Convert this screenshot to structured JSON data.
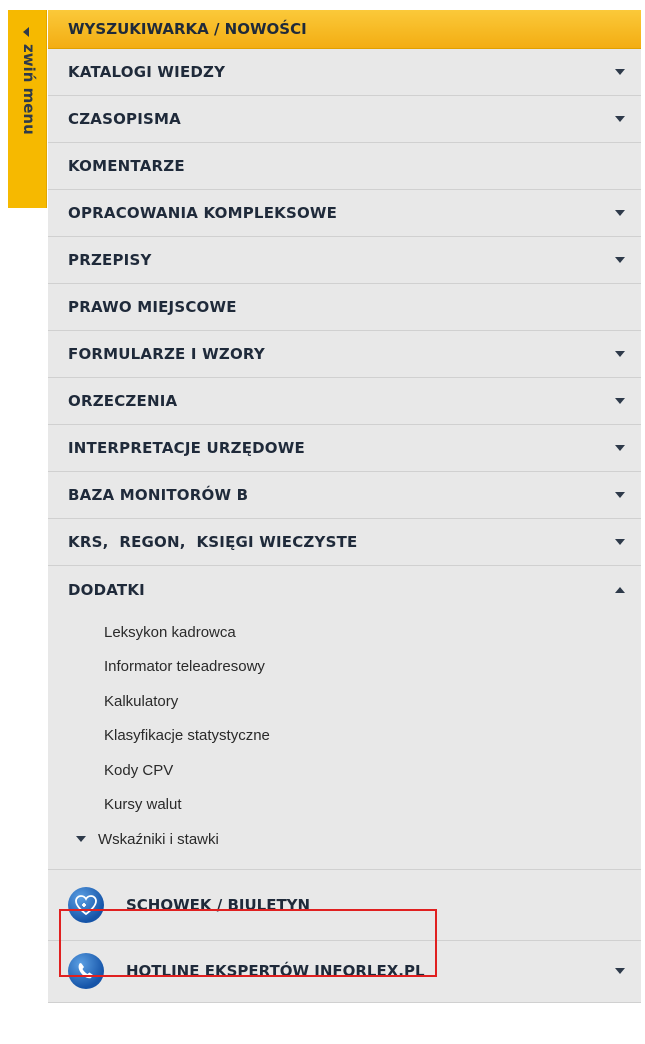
{
  "collapse_tab": {
    "label": "zwiń menu",
    "icon": "triangle-left-icon"
  },
  "header": {
    "label": "WYSZUKIWARKA / NOWOŚCI"
  },
  "menu_items": [
    {
      "label": "KATALOGI WIEDZY",
      "caret": "down"
    },
    {
      "label": "CZASOPISMA",
      "caret": "down"
    },
    {
      "label": "KOMENTARZE",
      "caret": "none"
    },
    {
      "label": "OPRACOWANIA KOMPLEKSOWE",
      "caret": "down"
    },
    {
      "label": "PRZEPISY",
      "caret": "down"
    },
    {
      "label": "PRAWO MIEJSCOWE",
      "caret": "none"
    },
    {
      "label": "FORMULARZE I WZORY",
      "caret": "down"
    },
    {
      "label": "ORZECZENIA",
      "caret": "down"
    },
    {
      "label": "INTERPRETACJE URZĘDOWE",
      "caret": "down"
    },
    {
      "label": "BAZA MONITORÓW B",
      "caret": "down"
    },
    {
      "label": "KRS,  REGON,  KSIĘGI WIECZYSTE",
      "caret": "down"
    },
    {
      "label": "DODATKI",
      "caret": "up"
    }
  ],
  "dodatki_submenu": [
    {
      "label": "Leksykon kadrowca"
    },
    {
      "label": "Informator teleadresowy"
    },
    {
      "label": "Kalkulatory"
    },
    {
      "label": "Klasyfikacje statystyczne"
    },
    {
      "label": "Kody CPV"
    },
    {
      "label": "Kursy walut"
    },
    {
      "label": "Wskaźniki i stawki"
    }
  ],
  "schowek": {
    "label": "SCHOWEK / BIULETYN",
    "icon": "heart-plus-icon"
  },
  "hotline": {
    "label": "HOTLINE EKSPERTÓW INFORLEX.PL",
    "icon": "phone-icon"
  },
  "colors": {
    "header_bg": "#f6b900",
    "item_bg": "#e8e8e8",
    "text": "#1f2a3a",
    "icon_blue": "#1554a8",
    "highlight": "#e02020"
  }
}
